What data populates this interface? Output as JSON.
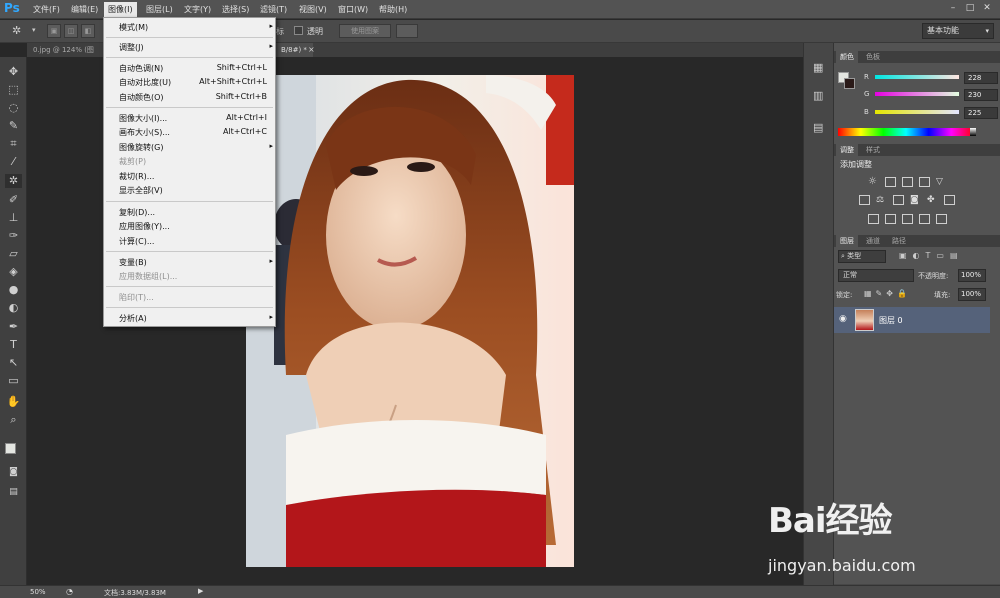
{
  "app": {
    "logo": "Ps"
  },
  "menubar": {
    "items": [
      "文件(F)",
      "编辑(E)",
      "图像(I)",
      "图层(L)",
      "文字(Y)",
      "选择(S)",
      "滤镜(T)",
      "视图(V)",
      "窗口(W)",
      "帮助(H)"
    ],
    "active": "图像(I)"
  },
  "optbar": {
    "transparent_label": "透明",
    "use_image_label": "使用图案",
    "workspace": "基本功能"
  },
  "tabs": [
    {
      "label": "0.jpg @ 124% (图"
    },
    {
      "label": "B/8#) *"
    }
  ],
  "image_menu": {
    "items": [
      {
        "label": "模式(M)",
        "shortcut": "",
        "submenu": true,
        "disabled": false
      },
      {
        "label": "调整(J)",
        "shortcut": "",
        "submenu": true,
        "disabled": false
      },
      {
        "label": "自动色调(N)",
        "shortcut": "Shift+Ctrl+L",
        "submenu": false,
        "disabled": false
      },
      {
        "label": "自动对比度(U)",
        "shortcut": "Alt+Shift+Ctrl+L",
        "submenu": false,
        "disabled": false
      },
      {
        "label": "自动颜色(O)",
        "shortcut": "Shift+Ctrl+B",
        "submenu": false,
        "disabled": false
      },
      {
        "label": "图像大小(I)...",
        "shortcut": "Alt+Ctrl+I",
        "submenu": false,
        "disabled": false
      },
      {
        "label": "画布大小(S)...",
        "shortcut": "Alt+Ctrl+C",
        "submenu": false,
        "disabled": false
      },
      {
        "label": "图像旋转(G)",
        "shortcut": "",
        "submenu": true,
        "disabled": false
      },
      {
        "label": "裁剪(P)",
        "shortcut": "",
        "submenu": false,
        "disabled": true
      },
      {
        "label": "裁切(R)...",
        "shortcut": "",
        "submenu": false,
        "disabled": false
      },
      {
        "label": "显示全部(V)",
        "shortcut": "",
        "submenu": false,
        "disabled": false
      },
      {
        "label": "复制(D)...",
        "shortcut": "",
        "submenu": false,
        "disabled": false
      },
      {
        "label": "应用图像(Y)...",
        "shortcut": "",
        "submenu": false,
        "disabled": false
      },
      {
        "label": "计算(C)...",
        "shortcut": "",
        "submenu": false,
        "disabled": false
      },
      {
        "label": "变量(B)",
        "shortcut": "",
        "submenu": true,
        "disabled": false
      },
      {
        "label": "应用数据组(L)...",
        "shortcut": "",
        "submenu": false,
        "disabled": true
      },
      {
        "label": "陷印(T)...",
        "shortcut": "",
        "submenu": false,
        "disabled": true
      },
      {
        "label": "分析(A)",
        "shortcut": "",
        "submenu": true,
        "disabled": false
      }
    ]
  },
  "color_panel": {
    "tabs": [
      "颜色",
      "色板"
    ],
    "r_label": "R",
    "g_label": "G",
    "b_label": "B",
    "r": "228",
    "g": "230",
    "b": "225"
  },
  "adjust_panel": {
    "tabs": [
      "调整",
      "样式"
    ],
    "title": "添加调整"
  },
  "layers_panel": {
    "tabs": [
      "图层",
      "通道",
      "路径"
    ],
    "filter": "类型",
    "blend_mode": "正常",
    "opacity_label": "不透明度:",
    "opacity": "100%",
    "lock_label": "锁定:",
    "fill_label": "填充:",
    "fill": "100%",
    "layer_name": "图层 0"
  },
  "status": {
    "zoom": "50%",
    "doc": "文档:3.83M/3.83M"
  },
  "watermark": {
    "logo": "Bai经验",
    "url": "jingyan.baidu.com"
  },
  "colors": {
    "menu_bg": "#535353",
    "selected_layer": "#55627a",
    "accent": "#31a8ff"
  }
}
